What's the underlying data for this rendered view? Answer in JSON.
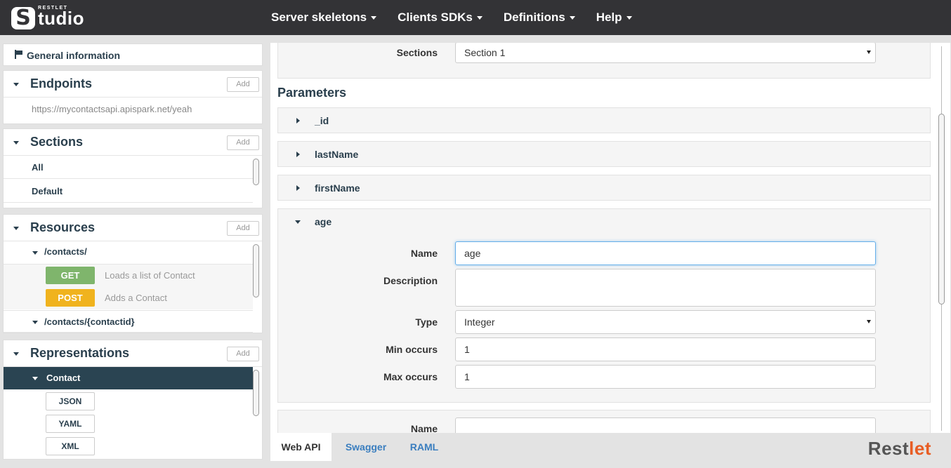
{
  "app": {
    "logo_small": "RESTLET",
    "logo_s": "S",
    "logo_main": "tudio",
    "nav": [
      "Server skeletons",
      "Clients SDKs",
      "Definitions",
      "Help"
    ]
  },
  "sidebar": {
    "general_info": "General information",
    "add_label": "Add",
    "endpoints": {
      "title": "Endpoints",
      "url": "https://mycontactsapi.apispark.net/yeah"
    },
    "sections": {
      "title": "Sections",
      "items": [
        "All",
        "Default"
      ]
    },
    "resources": {
      "title": "Resources",
      "items": [
        {
          "path": "/contacts/",
          "methods": [
            {
              "verb": "GET",
              "desc": "Loads a list of Contact",
              "color": "#7fb56c"
            },
            {
              "verb": "POST",
              "desc": "Adds a Contact",
              "color": "#f0b31e"
            }
          ]
        },
        {
          "path": "/contacts/{contactid}"
        }
      ]
    },
    "representations": {
      "title": "Representations",
      "selected": "Contact",
      "formats": [
        "JSON",
        "YAML",
        "XML"
      ]
    }
  },
  "main": {
    "sections_label": "Sections",
    "sections_value": "Section 1",
    "parameters_title": "Parameters",
    "params": [
      "_id",
      "lastName",
      "firstName"
    ],
    "expanded": {
      "name": "age",
      "fields": {
        "name_label": "Name",
        "name_value": "age",
        "description_label": "Description",
        "description_value": "",
        "type_label": "Type",
        "type_value": "Integer",
        "min_label": "Min occurs",
        "min_value": "1",
        "max_label": "Max occurs",
        "max_value": "1"
      }
    },
    "next_name_label": "Name"
  },
  "bottom": {
    "tabs": [
      "Web API",
      "Swagger",
      "RAML"
    ],
    "brand_a": "Rest",
    "brand_b": "let"
  },
  "colors": {
    "topbar": "#333336",
    "accent_dark": "#2a4452",
    "get": "#7fb56c",
    "post": "#f0b31e",
    "link": "#3a7ebf",
    "brand_orange": "#e85d24"
  }
}
